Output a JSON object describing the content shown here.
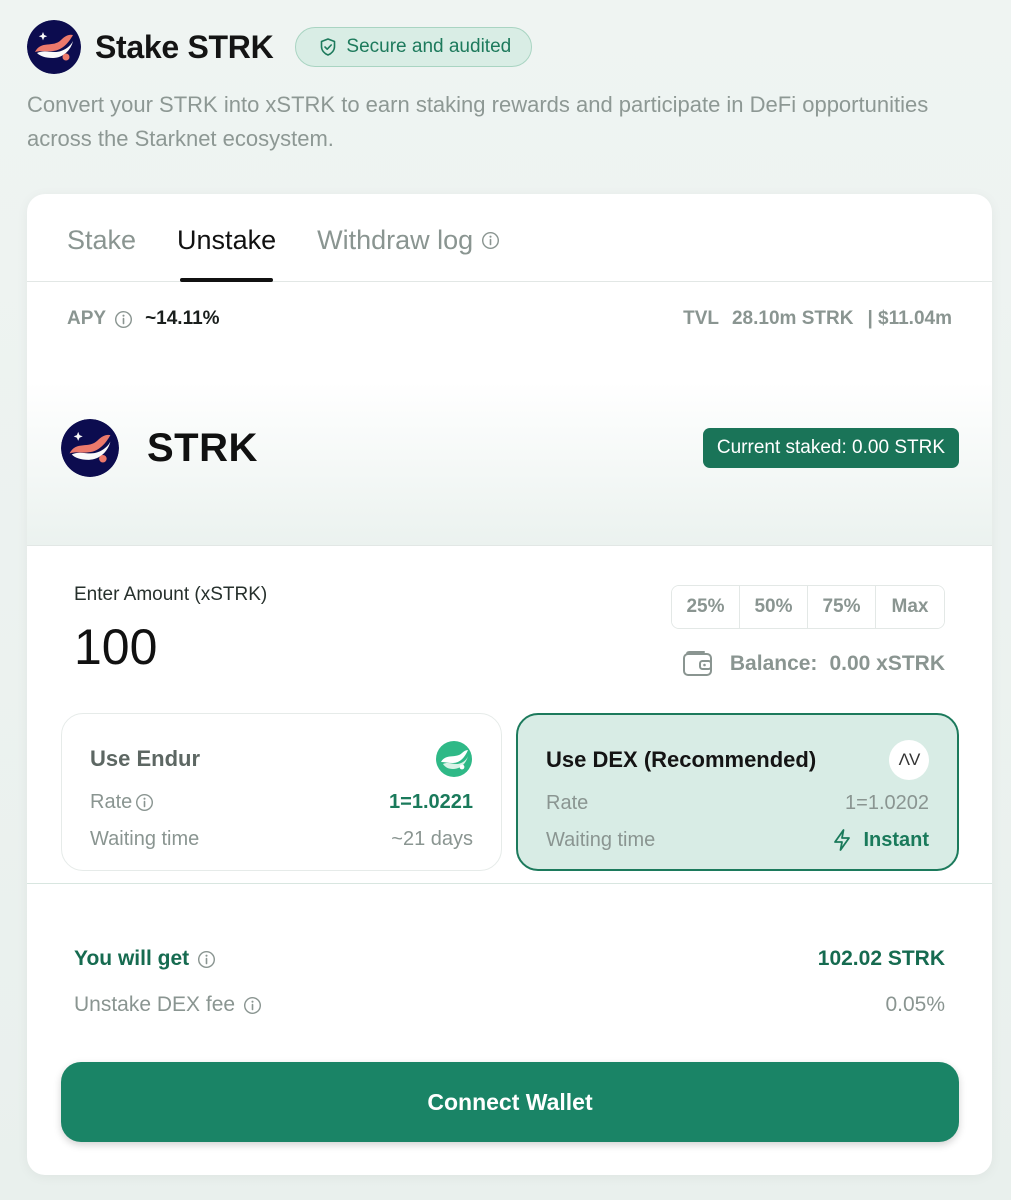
{
  "header": {
    "title": "Stake STRK",
    "badge": "Secure and audited",
    "subtitle": "Convert your STRK into xSTRK to earn staking rewards and participate in DeFi opportunities across the Starknet ecosystem."
  },
  "tabs": [
    {
      "label": "Stake",
      "active": false
    },
    {
      "label": "Unstake",
      "active": true
    },
    {
      "label": "Withdraw log",
      "active": false
    }
  ],
  "stats": {
    "apy_label": "APY",
    "apy_value": "~14.11%",
    "tvl_label": "TVL",
    "tvl_value": "28.10m STRK",
    "tvl_usd": "| $11.04m"
  },
  "token": {
    "name": "STRK",
    "staked": "Current staked: 0.00 STRK"
  },
  "amount": {
    "label": "Enter Amount (xSTRK)",
    "value": "100",
    "percent_buttons": [
      "25%",
      "50%",
      "75%",
      "Max"
    ],
    "balance_label": "Balance:",
    "balance_value": "0.00 xSTRK"
  },
  "options": {
    "endur": {
      "title": "Use Endur",
      "rate_label": "Rate",
      "rate_value": "1=1.0221",
      "wait_label": "Waiting time",
      "wait_value": "~21 days"
    },
    "dex": {
      "title": "Use DEX (Recommended)",
      "icon_text": "ΛV",
      "rate_label": "Rate",
      "rate_value": "1=1.0202",
      "wait_label": "Waiting time",
      "wait_value": "Instant"
    }
  },
  "summary": {
    "get_label": "You will get",
    "get_value": "102.02 STRK",
    "fee_label": "Unstake DEX fee",
    "fee_value": "0.05%"
  },
  "cta": "Connect Wallet",
  "colors": {
    "brand": "#1a8466",
    "accent_dark": "#1a7458",
    "dex_bg": "#d8ece5",
    "logo_bg": "#0c0c4f",
    "logo_accent": "#ec796b"
  }
}
